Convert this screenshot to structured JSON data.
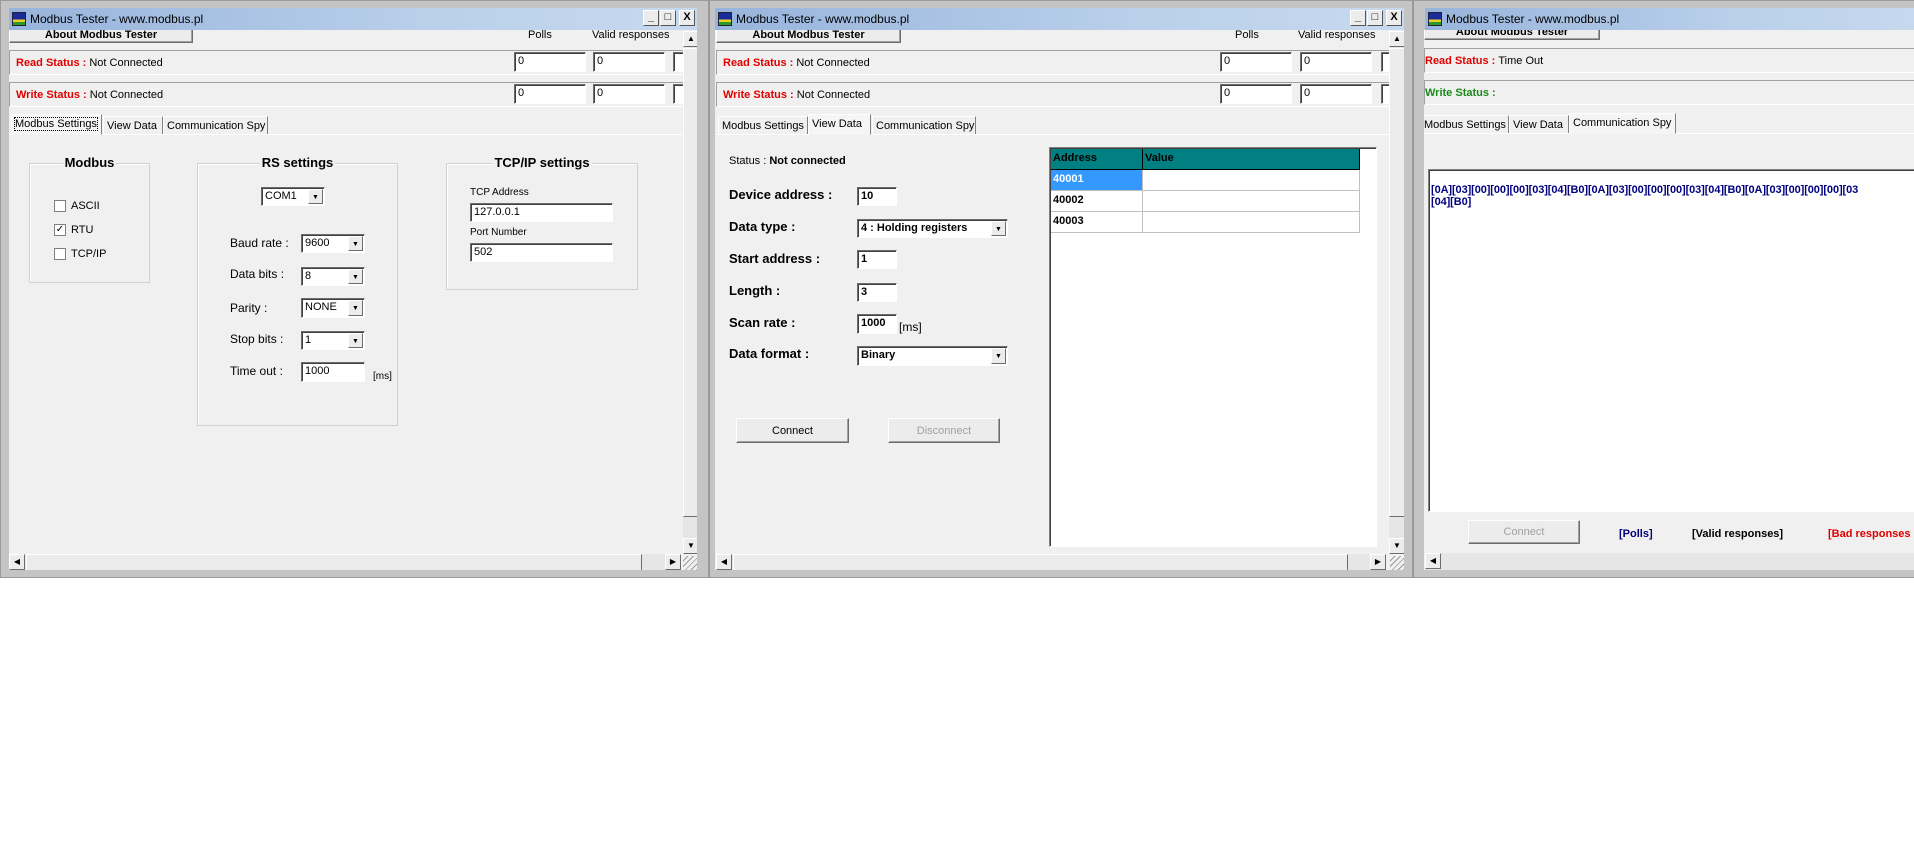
{
  "window_title": "Modbus Tester - www.modbus.pl",
  "title_buttons": {
    "minimize": "_",
    "maximize": "□",
    "close": "X"
  },
  "about_button": "About Modbus Tester",
  "counters": {
    "polls_label": "Polls",
    "valid_label": "Valid responses"
  },
  "tabs": [
    "Modbus Settings",
    "View Data",
    "Communication Spy"
  ],
  "window1": {
    "read_status_label": "Read Status :",
    "read_status_value": "Not Connected",
    "write_status_label": "Write Status :",
    "write_status_value": "Not Connected",
    "read_polls": "0",
    "read_valid": "0",
    "write_polls": "0",
    "write_valid": "0",
    "active_tab": "Modbus Settings",
    "modbus_group": {
      "title": "Modbus",
      "options": [
        {
          "label": "ASCII",
          "checked": false
        },
        {
          "label": "RTU",
          "checked": true
        },
        {
          "label": "TCP/IP",
          "checked": false
        }
      ]
    },
    "rs_group": {
      "title": "RS settings",
      "port": "COM1",
      "baud_label": "Baud rate :",
      "baud_value": "9600",
      "databits_label": "Data bits :",
      "databits_value": "8",
      "parity_label": "Parity :",
      "parity_value": "NONE",
      "stopbits_label": "Stop bits :",
      "stopbits_value": "1",
      "timeout_label": "Time out :",
      "timeout_value": "1000",
      "timeout_unit": "[ms]"
    },
    "tcp_group": {
      "title": "TCP/IP settings",
      "address_label": "TCP Address",
      "address_value": "127.0.0.1",
      "port_label": "Port Number",
      "port_value": "502"
    }
  },
  "window2": {
    "read_status_label": "Read Status :",
    "read_status_value": "Not Connected",
    "write_status_label": "Write Status :",
    "write_status_value": "Not Connected",
    "read_polls": "0",
    "read_valid": "0",
    "write_polls": "0",
    "write_valid": "0",
    "active_tab": "View Data",
    "status_label": "Status :",
    "status_value": "Not connected",
    "device_address_label": "Device address :",
    "device_address_value": "10",
    "data_type_label": "Data type :",
    "data_type_value": "4 : Holding registers",
    "start_address_label": "Start address :",
    "start_address_value": "1",
    "length_label": "Length :",
    "length_value": "3",
    "scan_rate_label": "Scan rate :",
    "scan_rate_value": "1000",
    "scan_rate_unit": "[ms]",
    "data_format_label": "Data format :",
    "data_format_value": "Binary",
    "connect_button": "Connect",
    "disconnect_button": "Disconnect",
    "grid": {
      "columns": [
        "Address",
        "Value"
      ],
      "rows": [
        {
          "address": "40001",
          "value": "",
          "selected": true
        },
        {
          "address": "40002",
          "value": ""
        },
        {
          "address": "40003",
          "value": ""
        }
      ],
      "header_color": "#008080",
      "selected_color": "#3399ff"
    }
  },
  "window3": {
    "read_status_label": "Read Status :",
    "read_status_value": "Time Out",
    "write_status_label": "Write Status :",
    "write_status_value": "",
    "active_tab": "Communication Spy",
    "spy_lines": [
      "[0A][03][00][00][00][03][04][B0][0A][03][00][00][00][03][04][B0][0A][03][00][00][00][03",
      "[04][B0]"
    ],
    "connect_button": "Connect",
    "legend_polls": "[Polls]",
    "legend_valid": "[Valid responses]",
    "legend_bad": "[Bad responses"
  }
}
